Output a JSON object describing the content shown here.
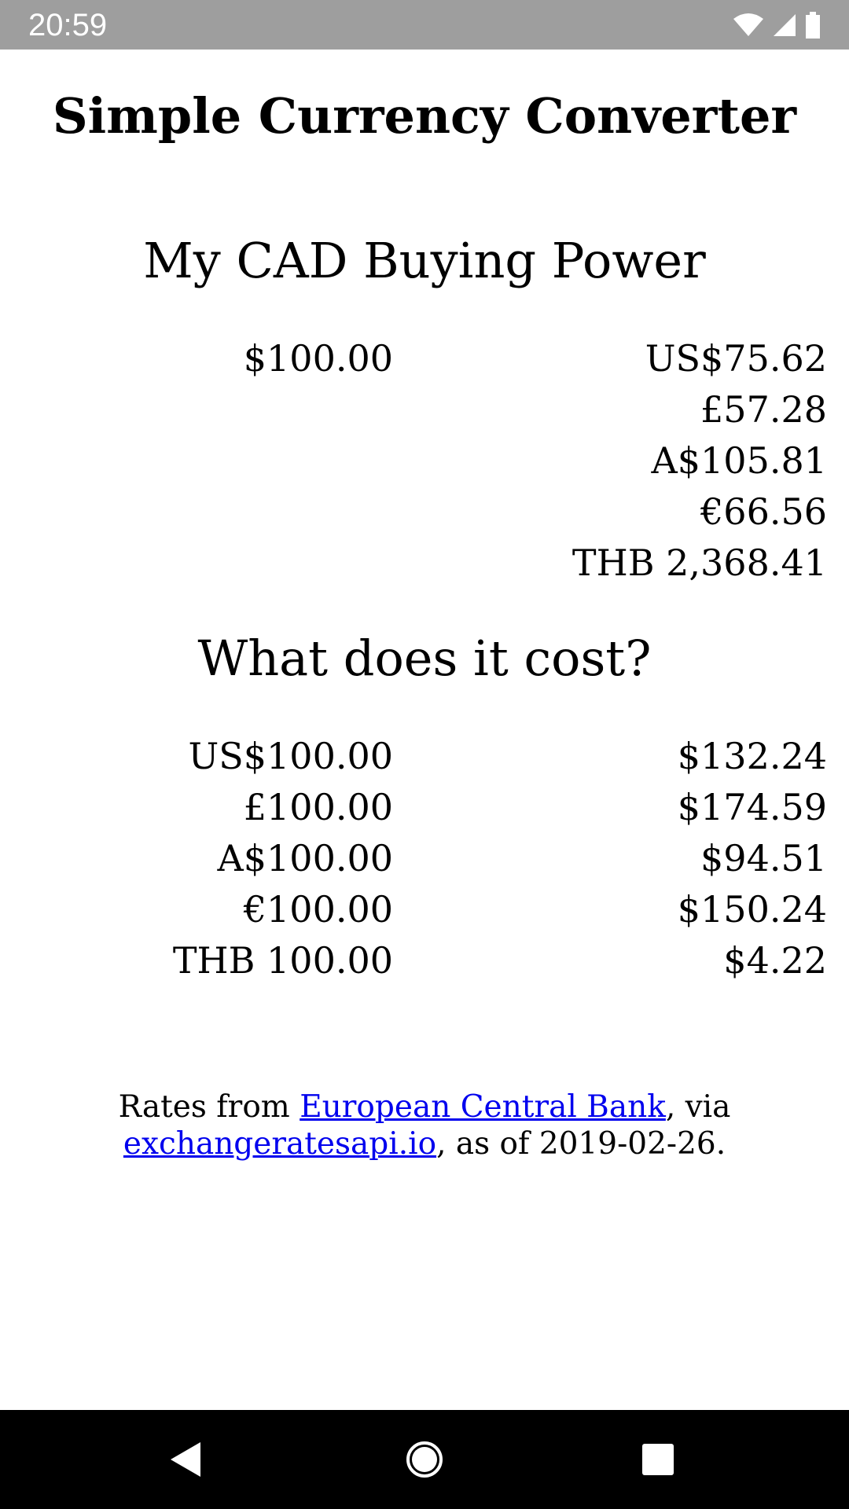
{
  "status_bar": {
    "time": "20:59",
    "icons": [
      "wifi-icon",
      "signal-icon",
      "battery-icon"
    ]
  },
  "app": {
    "title": "Simple Currency Converter"
  },
  "buying_power": {
    "title": "My CAD Buying Power",
    "rows": [
      {
        "from": "$100.00",
        "to": "US$75.62"
      },
      {
        "from": "",
        "to": "£57.28"
      },
      {
        "from": "",
        "to": "A$105.81"
      },
      {
        "from": "",
        "to": "€66.56"
      },
      {
        "from": "",
        "to": "THB 2,368.41"
      }
    ]
  },
  "cost": {
    "title": "What does it cost?",
    "rows": [
      {
        "from": "US$100.00",
        "to": "$132.24"
      },
      {
        "from": "£100.00",
        "to": "$174.59"
      },
      {
        "from": "A$100.00",
        "to": "$94.51"
      },
      {
        "from": "€100.00",
        "to": "$150.24"
      },
      {
        "from": "THB 100.00",
        "to": "$4.22"
      }
    ]
  },
  "footer": {
    "prefix": "Rates from ",
    "ecb_link": "European Central Bank",
    "middle": ", via",
    "api_link": "exchangeratesapi.io",
    "suffix": ", as of 2019-02-26."
  },
  "nav_bar": {
    "buttons": [
      "back-icon",
      "home-icon",
      "recents-icon"
    ]
  },
  "colors": {
    "status_bar_bg": "#9e9e9e",
    "nav_bar_bg": "#000000",
    "link": "#0000ee",
    "text": "#000000",
    "background": "#ffffff"
  }
}
